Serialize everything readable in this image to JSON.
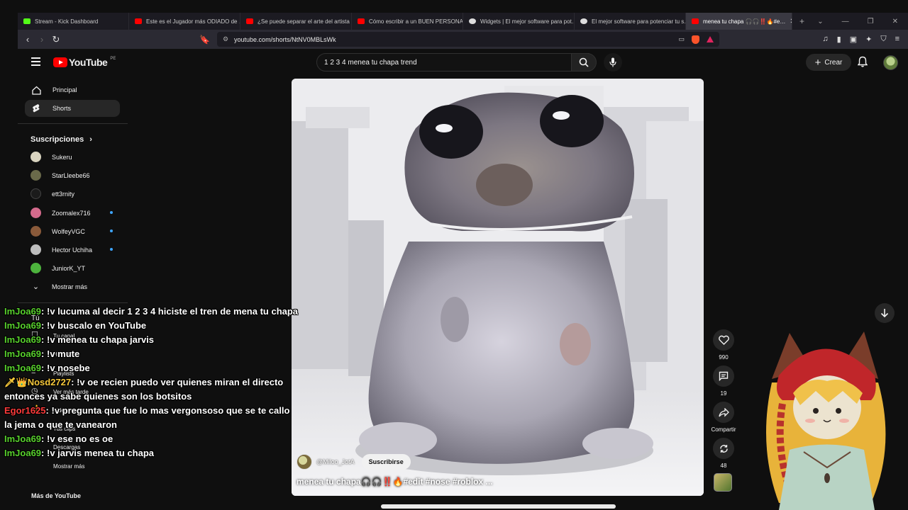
{
  "browser": {
    "tabs": [
      {
        "title": "Stream - Kick Dashboard",
        "favicon_color": "#53fc18"
      },
      {
        "title": "Este es el Jugador más ODIADO de …",
        "favicon_color": "#ff0000"
      },
      {
        "title": "¿Se puede separar el arte del artista",
        "favicon_color": "#ff0000"
      },
      {
        "title": "Cómo escribir a un BUEN PERSONA…",
        "favicon_color": "#ff0000"
      },
      {
        "title": "Widgets | El mejor software para pot…",
        "favicon_color": "#dddddd"
      },
      {
        "title": "El mejor software para potenciar tu s…",
        "favicon_color": "#dddddd"
      },
      {
        "title": "menea tu chapa 🎧🎧‼️🔥#e…",
        "favicon_color": "#ff0000"
      }
    ],
    "url": "youtube.com/shorts/NtNV0MBLsWk"
  },
  "youtube": {
    "logo_text": "YouTube",
    "country_code": "PE",
    "search_query": "1 2 3 4 menea tu chapa trend",
    "create_label": "Crear"
  },
  "sidebar": {
    "main": [
      {
        "label": "Principal"
      },
      {
        "label": "Shorts"
      }
    ],
    "subs_heading": "Suscripciones",
    "subscriptions": [
      {
        "name": "Sukeru",
        "avatar_color": "#d9d4c0",
        "live": false
      },
      {
        "name": "StarLleebe66",
        "avatar_color": "#6a6a4a",
        "live": false
      },
      {
        "name": "ett3rnity",
        "avatar_color": "#1b1b1b",
        "live": false
      },
      {
        "name": "Zoomalex716",
        "avatar_color": "#d46a8c",
        "live": true
      },
      {
        "name": "WolfeyVGC",
        "avatar_color": "#8a5a3a",
        "live": true
      },
      {
        "name": "Hector Uchiha",
        "avatar_color": "#bdbdbd",
        "live": true
      },
      {
        "name": "JuniorK_YT",
        "avatar_color": "#4db33d",
        "live": false
      }
    ],
    "show_more": "Mostrar más",
    "you_items": [
      {
        "label": "Tú"
      },
      {
        "label": "Tu canal"
      },
      {
        "label": "Historial"
      },
      {
        "label": "Playlists"
      },
      {
        "label": "Ver más tarde"
      },
      {
        "label": "Videos que me gus…"
      },
      {
        "label": "Tus clips"
      },
      {
        "label": "Descargas"
      },
      {
        "label": "Mostrar más"
      },
      {
        "label": "Más de YouTube"
      }
    ]
  },
  "short": {
    "channel": "@Miloo_JotA",
    "subscribe_label": "Suscribirse",
    "caption": "menea tu chapa🎧🎧‼️🔥#edit #nose #roblox ...",
    "likes": "990",
    "comments": "19",
    "share_label": "Compartir",
    "remixes": "48"
  },
  "chat": [
    {
      "user": "ImJoa69",
      "text": " !v lucuma al decir 1 2 3 4 hiciste el tren de mena tu chapa",
      "color": "green"
    },
    {
      "user": "ImJoa69",
      "text": " !v buscalo en YouTube",
      "color": "green"
    },
    {
      "user": "ImJoa69",
      "text": " !v menea tu chapa jarvis",
      "color": "green"
    },
    {
      "user": "ImJoa69",
      "text": " !v mute",
      "color": "green"
    },
    {
      "user": "ImJoa69",
      "text": " !v nosebe",
      "color": "green"
    },
    {
      "user": "🗡👑Nosd2727",
      "text": " !v oe recien puedo ver quienes miran el directo entonces ya sabe quienes son los botsitos",
      "color": "gold"
    },
    {
      "user": "Egor1625",
      "text": " !v pregunta que fue lo mas vergonsoso que se te callo la jema o que te vanearon",
      "color": "red"
    },
    {
      "user": "ImJoa69",
      "text": " !v ese no es oe",
      "color": "green"
    },
    {
      "user": "ImJoa69",
      "text": " !v jarvis menea tu chapa",
      "color": "green"
    }
  ]
}
